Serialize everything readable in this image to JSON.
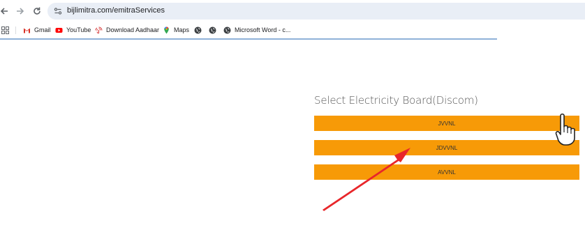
{
  "browser": {
    "url": "bijlimitra.com/emitraServices",
    "bookmarks": [
      {
        "label": "Gmail",
        "icon": "gmail-icon"
      },
      {
        "label": "YouTube",
        "icon": "youtube-icon"
      },
      {
        "label": "Download Aadhaar",
        "icon": "aadhaar-icon"
      },
      {
        "label": "Maps",
        "icon": "maps-icon"
      },
      {
        "label": "",
        "icon": "globe-icon"
      },
      {
        "label": "",
        "icon": "globe-icon"
      },
      {
        "label": "Microsoft Word - c...",
        "icon": "globe-icon"
      }
    ]
  },
  "page": {
    "heading": "Select Electricity Board(Discom)",
    "boards": [
      {
        "label": "JVVNL"
      },
      {
        "label": "JDVVNL"
      },
      {
        "label": "AVVNL"
      }
    ]
  },
  "colors": {
    "button": "#f79a07",
    "arrow": "#e8262a",
    "omnibox": "#e9eef6"
  }
}
